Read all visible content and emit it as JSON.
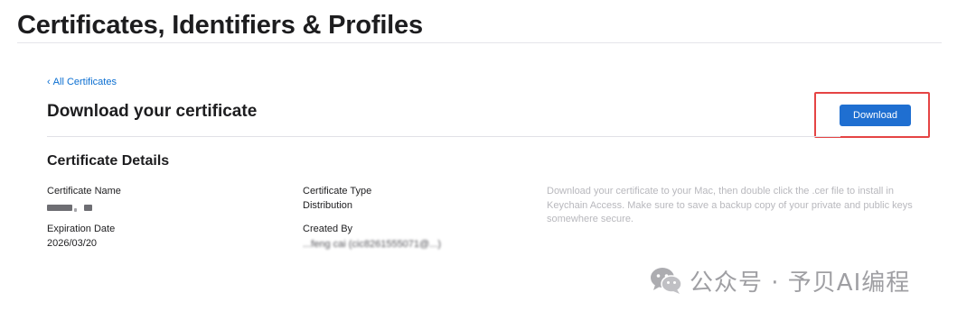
{
  "header": {
    "title": "Certificates, Identifiers & Profiles"
  },
  "breadcrumb": {
    "back_label": "All Certificates",
    "chevron": "‹"
  },
  "page": {
    "heading": "Download your certificate"
  },
  "actions": {
    "download_label": "Download",
    "accent_color": "#1f6fd1",
    "highlight_color": "#e54444"
  },
  "details": {
    "heading": "Certificate Details",
    "fields": {
      "certificate_name": {
        "label": "Certificate Name",
        "value": ""
      },
      "certificate_type": {
        "label": "Certificate Type",
        "value": "Distribution"
      },
      "expiration_date": {
        "label": "Expiration Date",
        "value": "2026/03/20"
      },
      "created_by": {
        "label": "Created By",
        "value_visible": "...feng cai (cic8261555071@...)"
      }
    },
    "help_text": "Download your certificate to your Mac, then double click the .cer file to install in Keychain Access. Make sure to save a backup copy of your private and public keys somewhere secure."
  },
  "watermark": {
    "icon": "wechat-icon",
    "text": "公众号 · 予贝AI编程"
  }
}
